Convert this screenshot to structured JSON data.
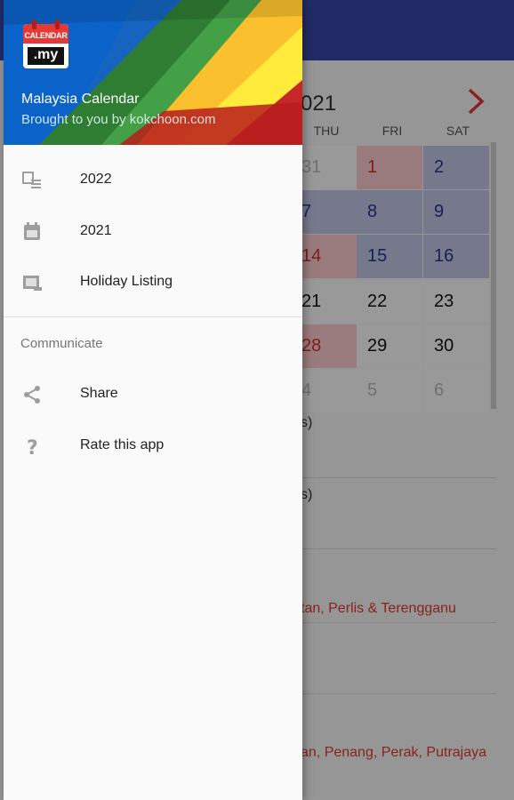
{
  "header": {
    "logo_top": "CALENDAR",
    "logo_bottom": ".my",
    "app_name": "Malaysia Calendar",
    "subtitle": "Brought to you by kokchoon.com"
  },
  "menu": {
    "items": [
      {
        "label": "2022",
        "icon": "calendar-list-icon"
      },
      {
        "label": "2021",
        "icon": "calendar-icon"
      },
      {
        "label": "Holiday Listing",
        "icon": "holiday-listing-icon"
      }
    ],
    "section_label": "Communicate",
    "communicate_items": [
      {
        "label": "Share",
        "icon": "share-icon"
      },
      {
        "label": "Rate this app",
        "icon": "help-icon"
      }
    ]
  },
  "background": {
    "month_title_fragment": "021",
    "day_headers": [
      "THU",
      "FRI",
      "SAT"
    ],
    "weeks": [
      [
        {
          "day": "31",
          "style": "gray"
        },
        {
          "day": "1",
          "style": "red"
        },
        {
          "day": "2",
          "style": "blue"
        }
      ],
      [
        {
          "day": "7",
          "style": "blue"
        },
        {
          "day": "8",
          "style": "blue"
        },
        {
          "day": "9",
          "style": "blue"
        }
      ],
      [
        {
          "day": "14",
          "style": "red"
        },
        {
          "day": "15",
          "style": "blue"
        },
        {
          "day": "16",
          "style": "blue"
        }
      ],
      [
        {
          "day": "21",
          "style": "white"
        },
        {
          "day": "22",
          "style": "white"
        },
        {
          "day": "23",
          "style": "white"
        }
      ],
      [
        {
          "day": "28",
          "style": "red"
        },
        {
          "day": "29",
          "style": "white"
        },
        {
          "day": "30",
          "style": "white"
        }
      ],
      [
        {
          "day": "4",
          "style": "gray"
        },
        {
          "day": "5",
          "style": "gray"
        },
        {
          "day": "6",
          "style": "gray"
        }
      ]
    ],
    "holiday_fragments": [
      "s)",
      "s)",
      "tan, Perlis & Terengganu",
      "an, Penang, Perak, Putrajaya"
    ]
  },
  "colors": {
    "appbar": "#3949ab",
    "holiday_red": "#e53935",
    "weekend_blue": "#283593"
  }
}
